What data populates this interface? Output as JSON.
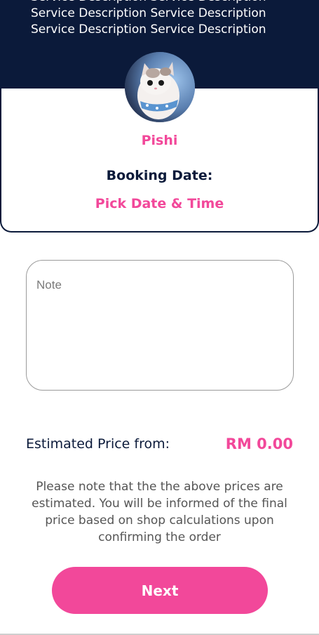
{
  "header": {
    "description_lines": [
      "Service Description Service Description",
      "Service Description Service Description",
      "Service Description Service Description"
    ],
    "background": "#0b1a3a"
  },
  "card": {
    "pet_name": "Pishi",
    "booking_label": "Booking Date:",
    "pick_date_label": "Pick Date & Time",
    "accent": "#f2489a"
  },
  "note": {
    "placeholder": "Note",
    "value": ""
  },
  "price": {
    "label": "Estimated Price from:",
    "value": "RM 0.00"
  },
  "disclaimer": "Please note that the the above prices are estimated. You will be informed of the final price based on shop calculations upon confirming the order",
  "actions": {
    "next_label": "Next"
  }
}
